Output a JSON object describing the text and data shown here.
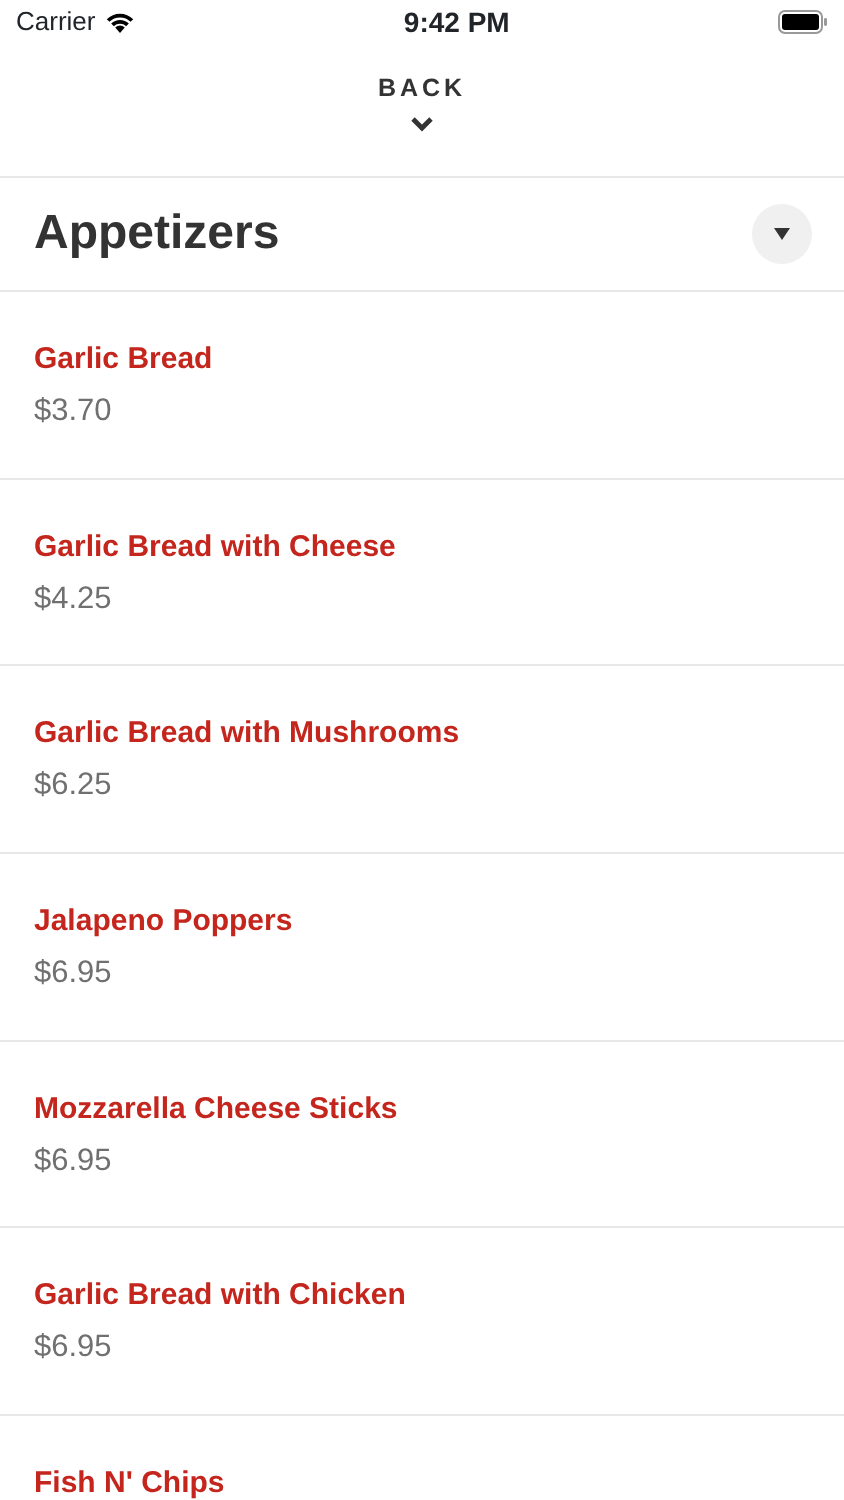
{
  "status_bar": {
    "carrier": "Carrier",
    "time": "9:42 PM"
  },
  "back": {
    "label": "BACK"
  },
  "category": {
    "title": "Appetizers"
  },
  "items": [
    {
      "name": "Garlic Bread",
      "price": "$3.70"
    },
    {
      "name": "Garlic Bread with Cheese",
      "price": "$4.25"
    },
    {
      "name": "Garlic Bread with Mushrooms",
      "price": "$6.25"
    },
    {
      "name": "Jalapeno Poppers",
      "price": "$6.95"
    },
    {
      "name": "Mozzarella Cheese Sticks",
      "price": "$6.95"
    },
    {
      "name": "Garlic Bread with Chicken",
      "price": "$6.95"
    },
    {
      "name": "Fish N' Chips"
    }
  ]
}
